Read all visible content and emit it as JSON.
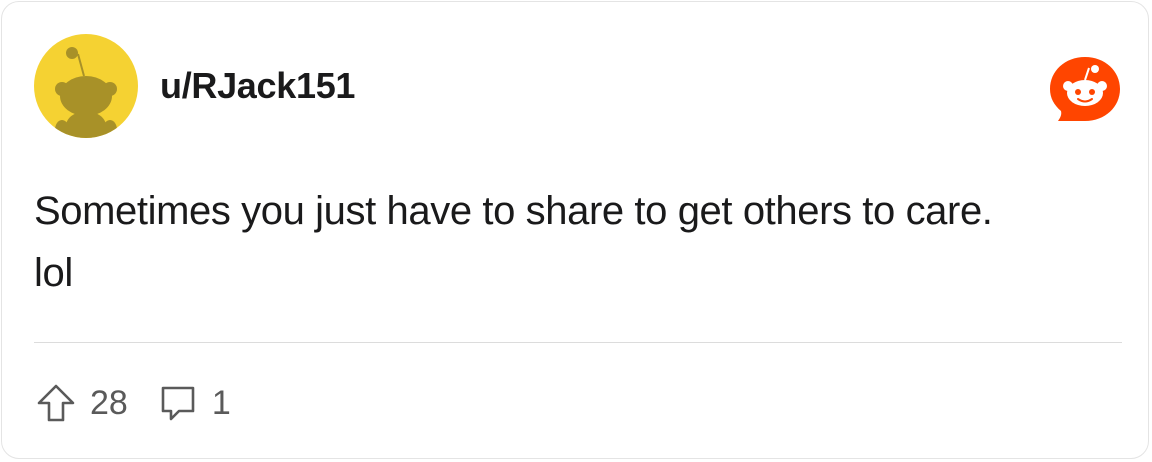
{
  "post": {
    "username": "u/RJack151",
    "body_lines": [
      "Sometimes you just have to share to get others to care.",
      "lol"
    ],
    "upvote_count": "28",
    "comment_count": "1"
  },
  "icons": {
    "avatar": "snoo-avatar-icon",
    "brand": "reddit-logo-icon",
    "upvote": "upvote-arrow-icon",
    "comment": "comment-bubble-icon"
  },
  "colors": {
    "avatar_background": "#F5D232",
    "avatar_figure": "#A89128",
    "brand_orange": "#FF4500",
    "text_primary": "#1A1A1B",
    "text_muted": "#5A5A5A",
    "divider": "#DCDCDC"
  }
}
